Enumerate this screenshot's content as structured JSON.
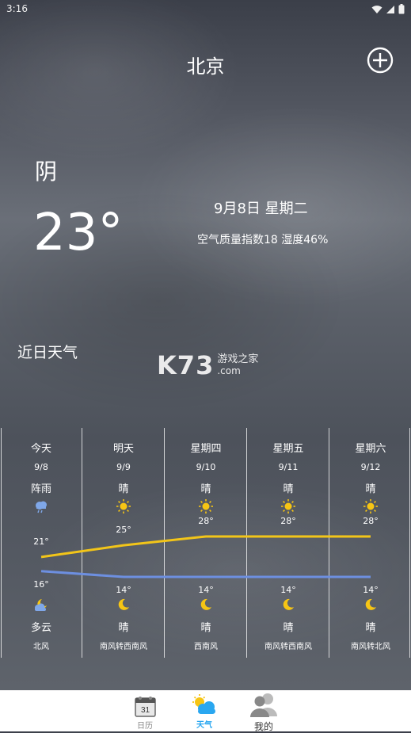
{
  "status_bar": {
    "time": "3:16"
  },
  "header": {
    "city": "北京"
  },
  "current": {
    "condition": "阴",
    "temperature": "23°",
    "date": "9月8日 星期二",
    "air_quality": "空气质量指数18 湿度46%"
  },
  "section_title": "近日天气",
  "watermark": {
    "brand": "K73",
    "line1": "游戏之家",
    "line2": ".com"
  },
  "forecast": [
    {
      "day": "今天",
      "date": "9/8",
      "day_condition": "阵雨",
      "day_icon": "shower-icon",
      "high": "21°",
      "high_value": 21,
      "low": "16°",
      "low_value": 16,
      "night_icon": "partly-cloudy-night-icon",
      "night_condition": "多云",
      "wind": "北风"
    },
    {
      "day": "明天",
      "date": "9/9",
      "day_condition": "晴",
      "day_icon": "sun-icon",
      "high": "25°",
      "high_value": 25,
      "low": "14°",
      "low_value": 14,
      "night_icon": "moon-icon",
      "night_condition": "晴",
      "wind": "南风转西南风"
    },
    {
      "day": "星期四",
      "date": "9/10",
      "day_condition": "晴",
      "day_icon": "sun-icon",
      "high": "28°",
      "high_value": 28,
      "low": "14°",
      "low_value": 14,
      "night_icon": "moon-icon",
      "night_condition": "晴",
      "wind": "西南风"
    },
    {
      "day": "星期五",
      "date": "9/11",
      "day_condition": "晴",
      "day_icon": "sun-icon",
      "high": "28°",
      "high_value": 28,
      "low": "14°",
      "low_value": 14,
      "night_icon": "moon-icon",
      "night_condition": "晴",
      "wind": "南风转西南风"
    },
    {
      "day": "星期六",
      "date": "9/12",
      "day_condition": "晴",
      "day_icon": "sun-icon",
      "high": "28°",
      "high_value": 28,
      "low": "14°",
      "low_value": 14,
      "night_icon": "moon-icon",
      "night_condition": "晴",
      "wind": "南风转北风"
    }
  ],
  "colors": {
    "high_line": "#f2c519",
    "low_line": "#6d8fe0",
    "sun": "#f6c514",
    "moon": "#f6c514",
    "nav_active": "#2aa7f0",
    "nav_inactive": "#888888"
  },
  "bottom_nav": {
    "items": [
      {
        "label": "日历",
        "icon": "calendar-icon",
        "badge": "31",
        "active": false
      },
      {
        "label": "天气",
        "icon": "weather-icon",
        "active": true
      },
      {
        "label": "我的",
        "icon": "user-icon",
        "active": false
      }
    ]
  }
}
